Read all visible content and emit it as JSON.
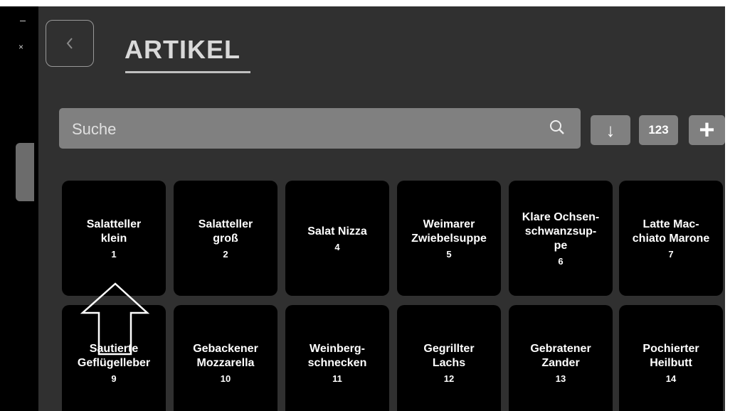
{
  "header": {
    "title": "ARTIKEL"
  },
  "search": {
    "placeholder": "Suche",
    "value": ""
  },
  "toolbar": {
    "sort_label": "↓",
    "number_label": "123",
    "add_label": "+"
  },
  "sidebar": {
    "close_glyph": "×"
  },
  "articles": [
    {
      "name": "Salatteller\nklein",
      "number": "1"
    },
    {
      "name": "Salatteller\ngroß",
      "number": "2"
    },
    {
      "name": "Salat Nizza",
      "number": "4"
    },
    {
      "name": "Weimarer\nZwiebelsuppe",
      "number": "5"
    },
    {
      "name": "Klare Ochsen-\nschwanzsup-\npe",
      "number": "6"
    },
    {
      "name": "Latte Mac-\nchiato Marone",
      "number": "7"
    },
    {
      "name": "Sautierte\nGeflügelleber",
      "number": "9"
    },
    {
      "name": "Gebackener\nMozzarella",
      "number": "10"
    },
    {
      "name": "Weinberg-\nschnecken",
      "number": "11"
    },
    {
      "name": "Gegrillter\nLachs",
      "number": "12"
    },
    {
      "name": "Gebratener\nZander",
      "number": "13"
    },
    {
      "name": "Pochierter\nHeilbutt",
      "number": "14"
    }
  ]
}
